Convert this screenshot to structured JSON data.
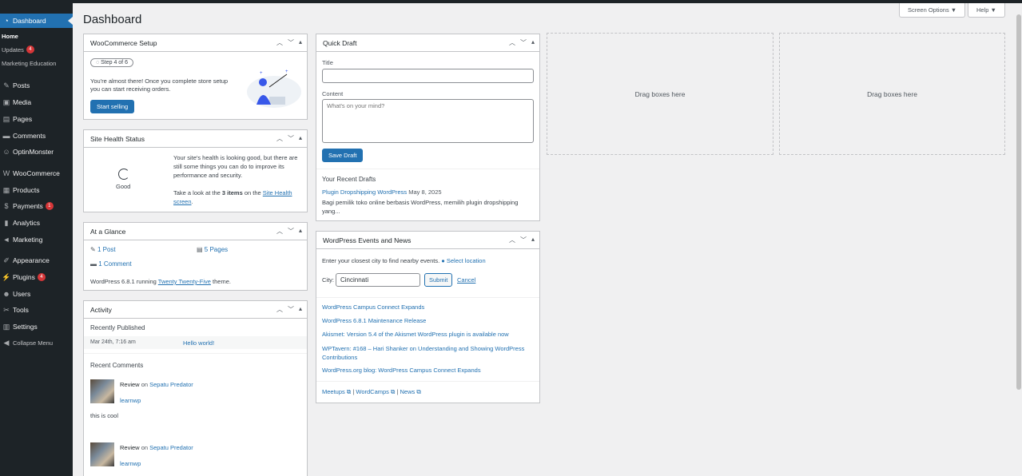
{
  "sidebar": {
    "dashboard": "Dashboard",
    "home": "Home",
    "updates": "Updates",
    "updates_count": "4",
    "marketing_education": "Marketing Education",
    "items": [
      {
        "label": "Posts",
        "icon": "pin-icon"
      },
      {
        "label": "Media",
        "icon": "media-icon"
      },
      {
        "label": "Pages",
        "icon": "pages-icon"
      },
      {
        "label": "Comments",
        "icon": "comments-icon"
      },
      {
        "label": "OptinMonster",
        "icon": "optinmonster-icon"
      },
      {
        "label": "WooCommerce",
        "icon": "woocommerce-icon"
      },
      {
        "label": "Products",
        "icon": "products-icon"
      },
      {
        "label": "Payments",
        "icon": "payments-icon",
        "badge": "1"
      },
      {
        "label": "Analytics",
        "icon": "analytics-icon"
      },
      {
        "label": "Marketing",
        "icon": "marketing-icon"
      },
      {
        "label": "Appearance",
        "icon": "appearance-icon"
      },
      {
        "label": "Plugins",
        "icon": "plugins-icon",
        "badge": "4"
      },
      {
        "label": "Users",
        "icon": "users-icon"
      },
      {
        "label": "Tools",
        "icon": "tools-icon"
      },
      {
        "label": "Settings",
        "icon": "settings-icon"
      },
      {
        "label": "Collapse Menu",
        "icon": "collapse-icon"
      }
    ]
  },
  "page": {
    "title": "Dashboard",
    "screen_options": "Screen Options ▼",
    "help": "Help ▼"
  },
  "woo": {
    "title": "WooCommerce Setup",
    "step": "Step 4 of 6",
    "text": "You're almost there! Once you complete store setup you can start receiving orders.",
    "button": "Start selling"
  },
  "health": {
    "title": "Site Health Status",
    "status": "Good",
    "text1": "Your site's health is looking good, but there are still some things you can do to improve its performance and security.",
    "text2_pre": "Take a look at the",
    "text2_bold": "3 items",
    "text2_mid": "on the",
    "text2_link": "Site Health screen",
    "text2_end": "."
  },
  "glance": {
    "title": "At a Glance",
    "posts": "1 Post",
    "pages": "5 Pages",
    "comments": "1 Comment",
    "running_pre": "WordPress 6.8.1 running",
    "theme": "Twenty Twenty-Five",
    "running_post": "theme."
  },
  "activity": {
    "title": "Activity",
    "recently_published": "Recently Published",
    "pub_date": "Mar 24th, 7:16 am",
    "pub_title": "Hello world!",
    "recent_comments": "Recent Comments",
    "comments": [
      {
        "author_action": "Review",
        "on": "on",
        "post": "Sepatu Predator",
        "user": "learnwp",
        "text": "this is cool"
      },
      {
        "author_action": "Review",
        "on": "on",
        "post": "Sepatu Predator",
        "user": "learnwp",
        "text": ""
      }
    ]
  },
  "draft": {
    "title": "Quick Draft",
    "title_label": "Title",
    "title_value": "",
    "content_label": "Content",
    "content_placeholder": "What's on your mind?",
    "save": "Save Draft",
    "recent_title": "Your Recent Drafts",
    "recent_link": "Plugin Dropshipping WordPress",
    "recent_date": "May 8, 2025",
    "recent_excerpt": "Bagi pemilik toko online berbasis WordPress, memilih plugin dropshipping yang..."
  },
  "events": {
    "title": "WordPress Events and News",
    "intro": "Enter your closest city to find nearby events.",
    "select_location": "Select location",
    "city_label": "City:",
    "city_value": "Cincinnati",
    "submit": "Submit",
    "cancel": "Cancel",
    "news": [
      "WordPress Campus Connect Expands",
      "WordPress 6.8.1 Maintenance Release",
      "Akismet: Version 5.4 of the Akismet WordPress plugin is available now",
      "WPTavern: #168 – Hari Shanker on Understanding and Showing WordPress Contributions",
      "WordPress.org blog: WordPress Campus Connect Expands"
    ],
    "footer": [
      "Meetups",
      "WordCamps",
      "News"
    ]
  },
  "dropzones": [
    "Drag boxes here",
    "Drag boxes here"
  ]
}
